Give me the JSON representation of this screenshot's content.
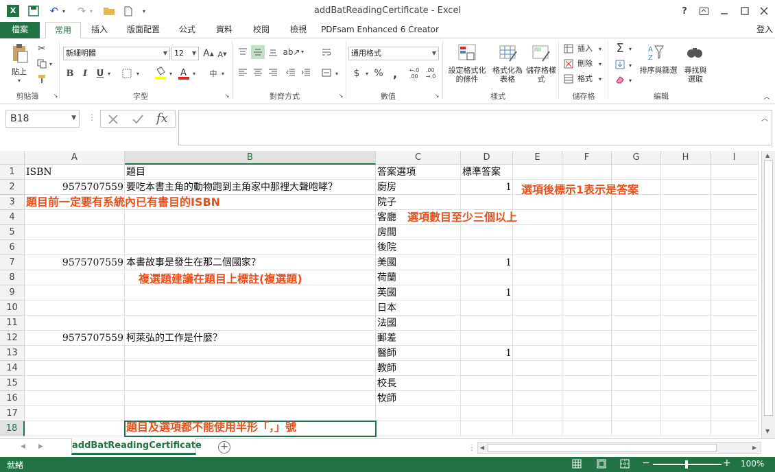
{
  "title": "addBatReadingCertificate - Excel",
  "window_controls": {
    "help": "?",
    "restore": "□",
    "min": "—",
    "max": "□",
    "close": "✕"
  },
  "tabs": [
    "檔案",
    "常用",
    "插入",
    "版面配置",
    "公式",
    "資料",
    "校閱",
    "檢視",
    "PDFsam Enhanced 6 Creator"
  ],
  "signin": "登入",
  "ribbon": {
    "paste": "貼上",
    "clipboard": "剪貼簿",
    "font_name": "新細明體",
    "font_size": "12",
    "font_group": "字型",
    "bold": "B",
    "italic": "I",
    "underline": "U",
    "align_group": "對齊方式",
    "number_format": "通用格式",
    "number_group": "數值",
    "cond_format": "設定格式化的條件",
    "format_table": "格式化為表格",
    "cell_styles": "儲存格樣式",
    "styles_group": "樣式",
    "insert": "插入",
    "delete": "刪除",
    "format": "格式",
    "cells_group": "儲存格",
    "sort_filter": "排序與篩選",
    "find_select": "尋找與選取",
    "edit_group": "編輯"
  },
  "name_box": "B18",
  "fx": "fx",
  "columns": [
    "A",
    "B",
    "C",
    "D",
    "E",
    "F",
    "G",
    "H",
    "I"
  ],
  "rows": [
    "1",
    "2",
    "3",
    "4",
    "5",
    "6",
    "7",
    "8",
    "9",
    "10",
    "11",
    "12",
    "13",
    "14",
    "15",
    "16",
    "17",
    "18"
  ],
  "cells": {
    "A1": "ISBN",
    "B1": "題目",
    "C1": "答案選項",
    "D1": "標準答案",
    "A2": "9575707559",
    "B2": "要吃本書主角的動物跑到主角家中那裡大聲咆哮？",
    "C2": "廚房",
    "D2": "1",
    "C3": "院子",
    "C4": "客廳",
    "C5": "房間",
    "C6": "後院",
    "A7": "9575707559",
    "B7": "本書故事是發生在那二個國家？",
    "C7": "美國",
    "D7": "1",
    "C8": "荷蘭",
    "C9": "英國",
    "D9": "1",
    "C10": "日本",
    "C11": "法國",
    "A12": "9575707559",
    "B12": "柯萊弘的工作是什麼？",
    "C12": "郵差",
    "C13": "醫師",
    "D13": "1",
    "C14": "教師",
    "C15": "校長",
    "C16": "牧師"
  },
  "annotations": {
    "isbn_note": "題目前一定要有系統內已有書目的ISBN",
    "answer_note": "選項後標示1表示是答案",
    "options_note": "選項數目至少三個以上",
    "multi_note": "複選題建議在題目上標註(複選題)",
    "comma_note": "題目及選項都不能使用半形「，」號"
  },
  "sheet_tab": "addBatReadingCertificate",
  "status_text": "就緒",
  "zoom": "100%",
  "colors": {
    "accent": "#217346",
    "annotation": "#e8501c",
    "selection": "#217346"
  }
}
